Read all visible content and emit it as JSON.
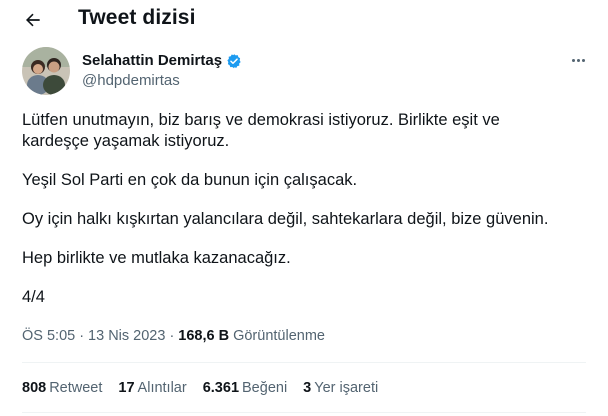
{
  "header": {
    "title": "Tweet dizisi"
  },
  "author": {
    "name": "Selahattin Demirtaş",
    "handle": "@hdpdemirtas"
  },
  "tweet": {
    "paragraphs": [
      [
        "Lütfen unutmayın, biz barış ve demokrasi istiyoruz. Birlikte eşit ve",
        "kardeşçe yaşamak istiyoruz."
      ],
      [
        "Yeşil Sol Parti en çok da bunun için çalışacak."
      ],
      [
        "Oy için halkı kışkırtan yalancılara değil, sahtekarlara değil, bize güvenin."
      ],
      [
        "Hep birlikte ve mutlaka kazanacağız."
      ],
      [
        "4/4"
      ]
    ]
  },
  "meta": {
    "time": "ÖS 5:05",
    "sep1": "·",
    "date": "13 Nis 2023",
    "sep2": "·",
    "views": "168,6 B",
    "views_label": "Görüntülenme"
  },
  "stats": [
    {
      "count": "808",
      "label": "Retweet"
    },
    {
      "count": "17",
      "label": "Alıntılar"
    },
    {
      "count": "6.361",
      "label": "Beğeni"
    },
    {
      "count": "3",
      "label": "Yer işareti"
    }
  ],
  "colors": {
    "text": "#0f1419",
    "muted": "#536471",
    "verified": "#1d9bf0",
    "divider": "#eff3f4"
  }
}
